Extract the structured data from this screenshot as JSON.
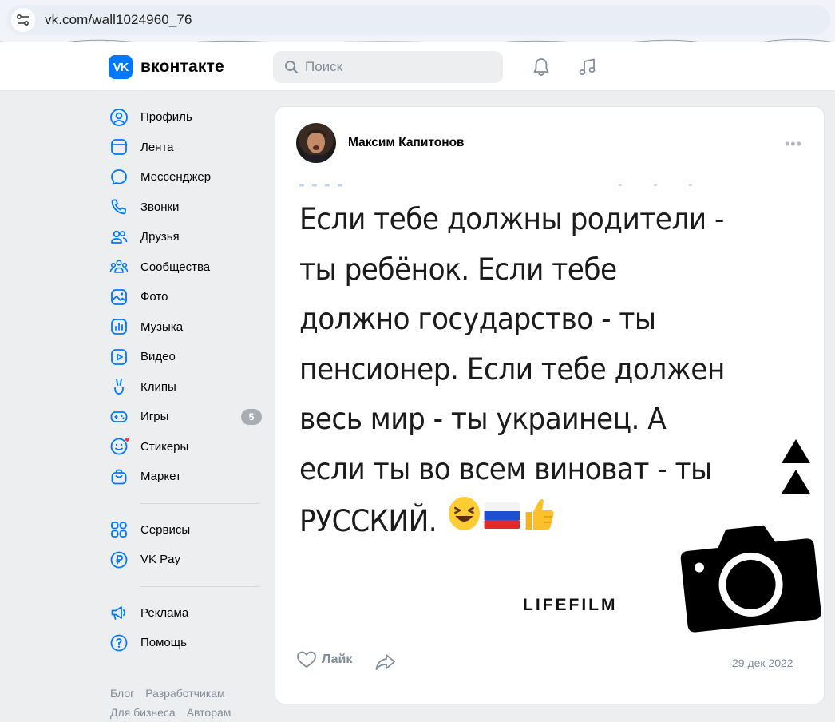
{
  "browser": {
    "url": "vk.com/wall1024960_76"
  },
  "header": {
    "logo_text": "вконтакте",
    "search_placeholder": "Поиск"
  },
  "sidebar": {
    "items": [
      {
        "label": "Профиль",
        "icon": "profile-icon"
      },
      {
        "label": "Лента",
        "icon": "feed-icon"
      },
      {
        "label": "Мессенджер",
        "icon": "messenger-icon"
      },
      {
        "label": "Звонки",
        "icon": "phone-icon"
      },
      {
        "label": "Друзья",
        "icon": "friends-icon"
      },
      {
        "label": "Сообщества",
        "icon": "communities-icon"
      },
      {
        "label": "Фото",
        "icon": "photo-icon"
      },
      {
        "label": "Музыка",
        "icon": "music-icon"
      },
      {
        "label": "Видео",
        "icon": "video-icon"
      },
      {
        "label": "Клипы",
        "icon": "clips-icon"
      },
      {
        "label": "Игры",
        "icon": "games-icon",
        "badge": "5"
      },
      {
        "label": "Стикеры",
        "icon": "stickers-icon"
      },
      {
        "label": "Маркет",
        "icon": "market-icon"
      }
    ],
    "services": [
      {
        "label": "Сервисы",
        "icon": "services-icon"
      },
      {
        "label": "VK Pay",
        "icon": "vkpay-icon"
      }
    ],
    "misc": [
      {
        "label": "Реклама",
        "icon": "ads-icon"
      },
      {
        "label": "Помощь",
        "icon": "help-icon"
      }
    ],
    "footer": [
      "Блог",
      "Разработчикам",
      "Для бизнеса",
      "Авторам"
    ]
  },
  "post": {
    "author": "Максим Капитонов",
    "lines": [
      "Если тебе должны родители -",
      "ты ребёнок. Если тебе",
      "должно государство - ты",
      "пенсионер. Если тебе должен",
      "весь мир - ты украинец. А",
      "если ты во всем виноват - ты",
      "РУССКИЙ."
    ],
    "watermark": "LIFEFILM",
    "like_label": "Лайк",
    "date": "29 дек 2022"
  },
  "colors": {
    "accent": "#0077ff",
    "background": "#edeef0",
    "muted": "#818c99"
  }
}
